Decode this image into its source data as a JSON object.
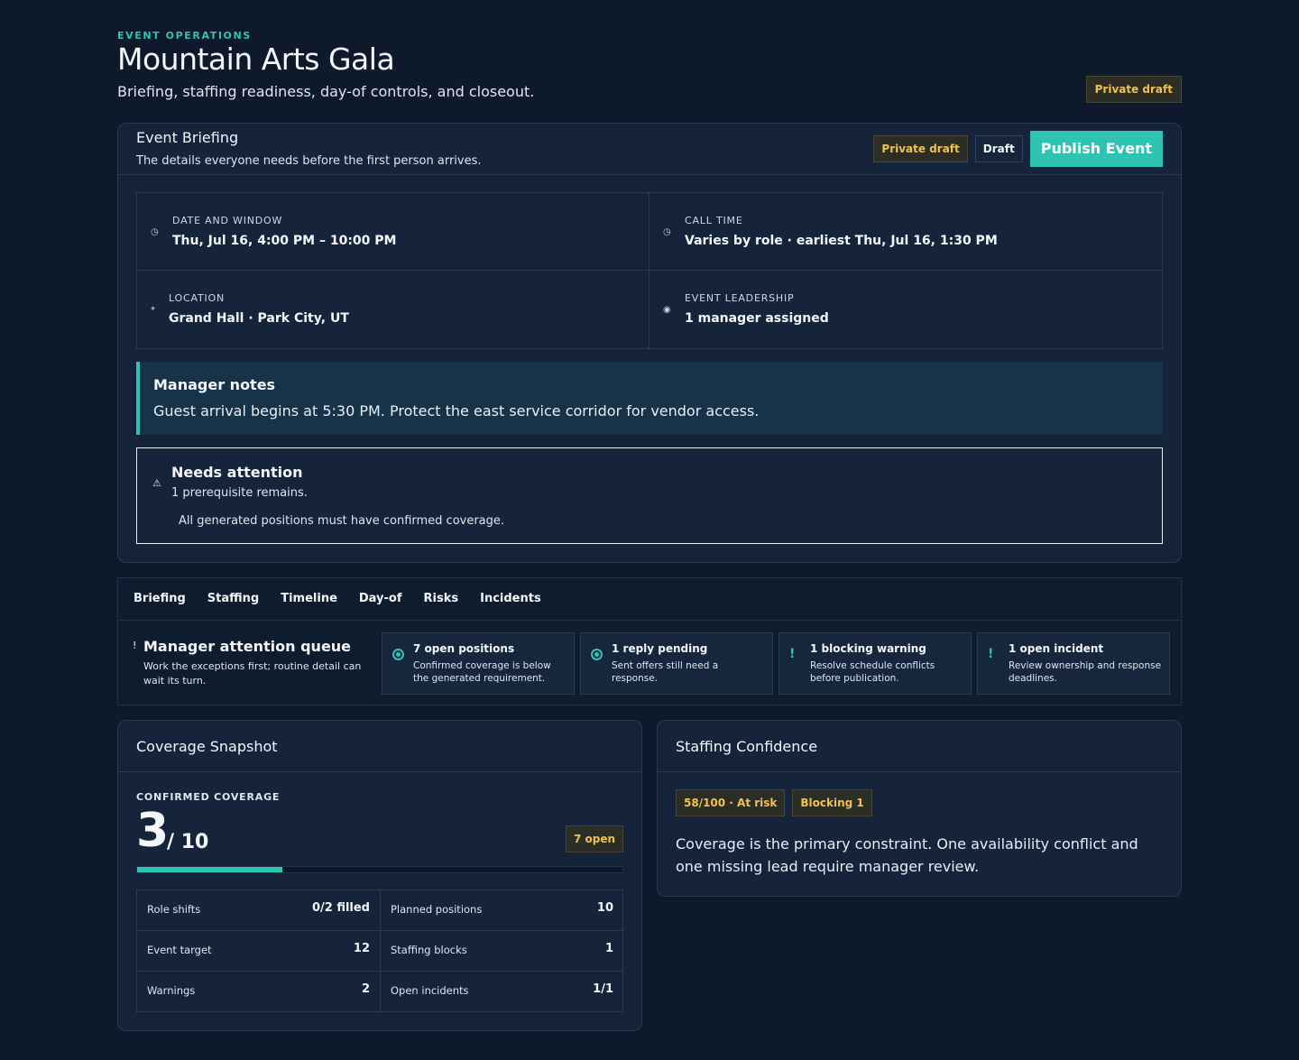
{
  "header": {
    "eyebrow": "EVENT OPERATIONS",
    "title": "Mountain Arts Gala",
    "subtitle": "Briefing, staffing readiness, day-of controls, and closeout.",
    "status_badge": "Private draft"
  },
  "briefing": {
    "title": "Event Briefing",
    "subtitle": "The details everyone needs before the first person arrives.",
    "visibility_badge": "Private draft",
    "state_badge": "Draft",
    "publish_label": "Publish Event",
    "details": [
      {
        "icon": "clock-icon",
        "label": "DATE AND WINDOW",
        "value": "Thu, Jul 16, 4:00 PM – 10:00 PM"
      },
      {
        "icon": "clock-icon",
        "label": "CALL TIME",
        "value": "Varies by role · earliest Thu, Jul 16, 1:30 PM"
      },
      {
        "icon": "location-pin-icon",
        "label": "LOCATION",
        "value": "Grand Hall · Park City, UT"
      },
      {
        "icon": "person-icon",
        "label": "EVENT LEADERSHIP",
        "value": "1 manager assigned"
      }
    ],
    "notes": {
      "title": "Manager notes",
      "text": "Guest arrival begins at 5:30 PM. Protect the east service corridor for vendor access."
    },
    "attention": {
      "title": "Needs attention",
      "summary": "1 prerequisite remains.",
      "items": [
        "All generated positions must have confirmed coverage."
      ]
    }
  },
  "tabs": [
    "Briefing",
    "Staffing",
    "Timeline",
    "Day-of",
    "Risks",
    "Incidents"
  ],
  "queue": {
    "title": "Manager attention queue",
    "description": "Work the exceptions first; routine detail can wait its turn.",
    "cards": [
      {
        "icon": "radio-dot-icon",
        "title": "7 open positions",
        "text": "Confirmed coverage is below the generated requirement."
      },
      {
        "icon": "radio-dot-icon",
        "title": "1 reply pending",
        "text": "Sent offers still need a response."
      },
      {
        "icon": "exclamation-icon",
        "title": "1 blocking warning",
        "text": "Resolve schedule conflicts before publication."
      },
      {
        "icon": "exclamation-icon",
        "title": "1 open incident",
        "text": "Review ownership and response deadlines."
      }
    ]
  },
  "coverage": {
    "title": "Coverage Snapshot",
    "label": "CONFIRMED COVERAGE",
    "confirmed": "3",
    "total": "/ 10",
    "open_badge": "7 open",
    "progress_fraction": 0.3,
    "accent_color": "#2ec4b1",
    "stats": [
      {
        "label": "Role shifts",
        "value": "0/2 filled"
      },
      {
        "label": "Planned positions",
        "value": "10"
      },
      {
        "label": "Event target",
        "value": "12"
      },
      {
        "label": "Staffing blocks",
        "value": "1"
      },
      {
        "label": "Warnings",
        "value": "2"
      },
      {
        "label": "Open incidents",
        "value": "1/1"
      }
    ]
  },
  "confidence": {
    "title": "Staffing Confidence",
    "score_badge": "58/100 · At risk",
    "blocking_badge": "Blocking 1",
    "text": "Coverage is the primary constraint. One availability conflict and one missing lead require manager review."
  }
}
